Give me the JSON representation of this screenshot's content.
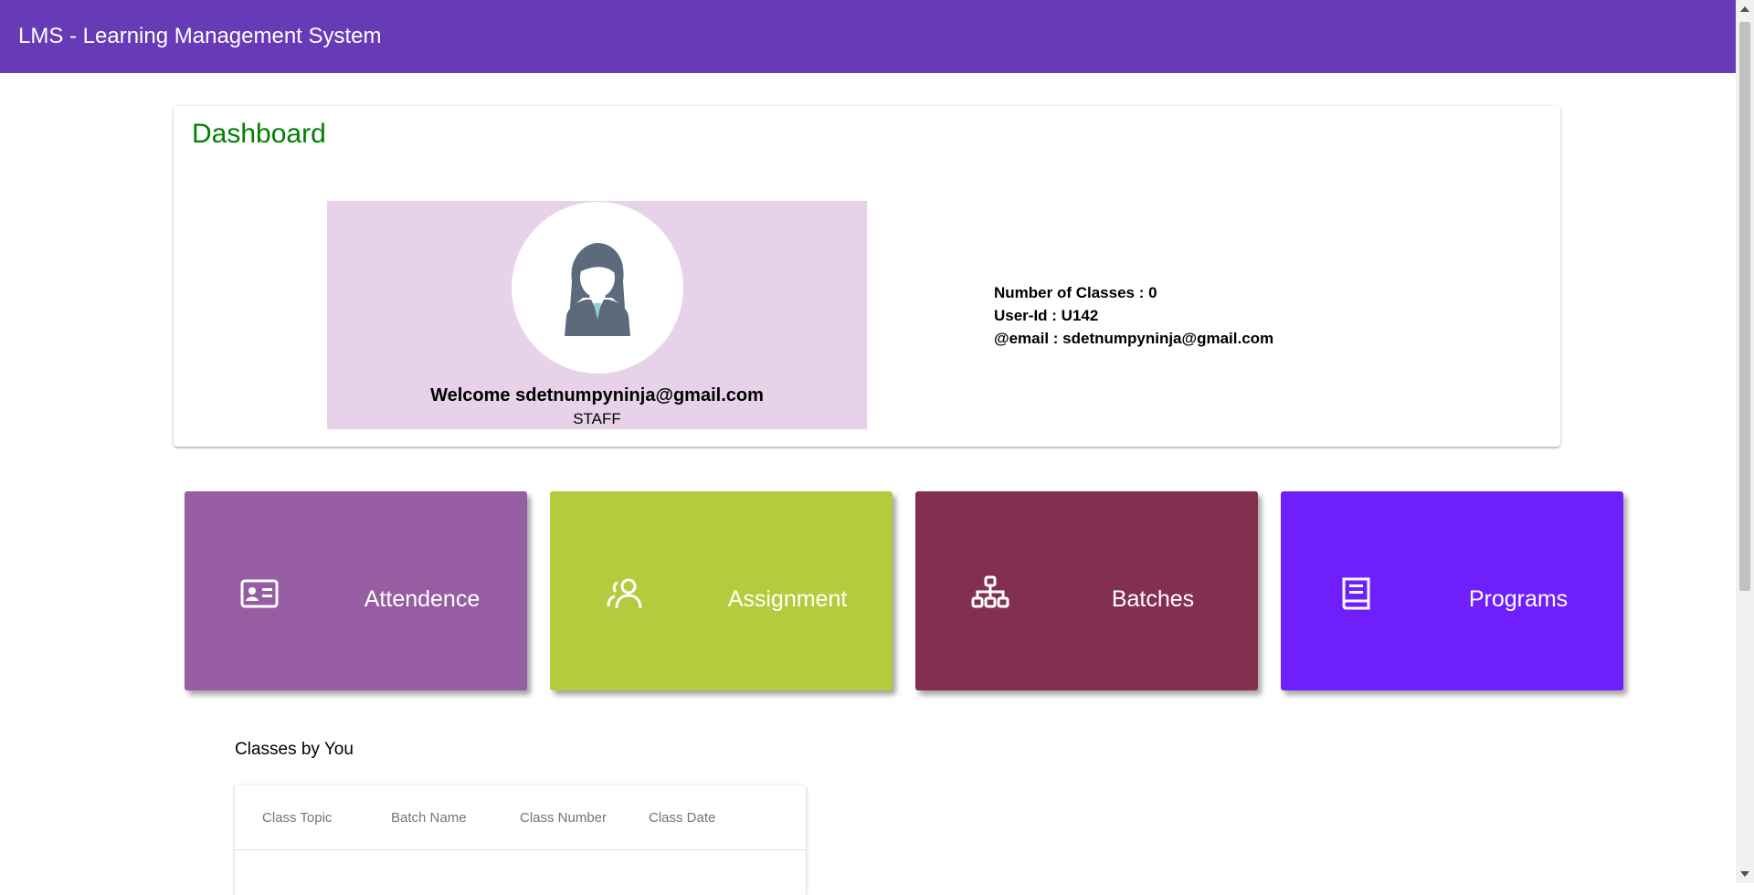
{
  "app": {
    "title": "LMS - Learning Management System"
  },
  "dashboard": {
    "heading": "Dashboard",
    "profile": {
      "welcome": "Welcome sdetnumpyninja@gmail.com",
      "role": "STAFF",
      "avatar_icon": "female-user-avatar-icon"
    },
    "info": {
      "classes": "Number of Classes : 0",
      "user_id": "User-Id : U142",
      "email": "@email : sdetnumpyninja@gmail.com"
    }
  },
  "tiles": [
    {
      "label": "Attendence",
      "icon": "id-card-icon",
      "color": "#965da2"
    },
    {
      "label": "Assignment",
      "icon": "users-icon",
      "color": "#b3cb3c"
    },
    {
      "label": "Batches",
      "icon": "sitemap-icon",
      "color": "#833050"
    },
    {
      "label": "Programs",
      "icon": "book-icon",
      "color": "#6e1ffc"
    }
  ],
  "classes": {
    "title": "Classes by You",
    "columns": [
      "Class Topic",
      "Batch Name",
      "Class Number",
      "Class Date"
    ]
  },
  "colors": {
    "header": "#673ab7",
    "heading": "#008000",
    "profile_bg": "#e8d2ea"
  }
}
